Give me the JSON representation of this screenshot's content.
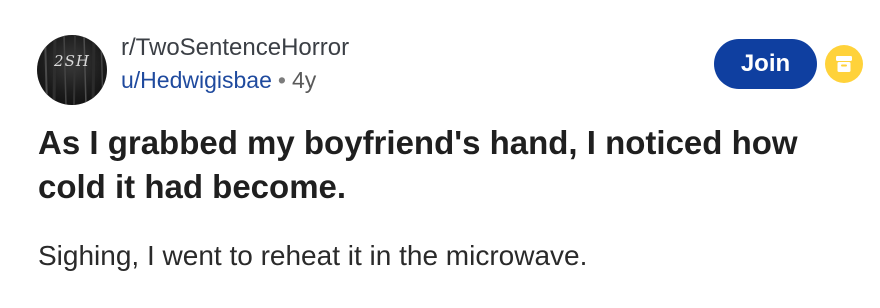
{
  "post": {
    "subreddit": "r/TwoSentenceHorror",
    "username": "u/Hedwigisbae",
    "separator": "•",
    "age": "4y",
    "avatar_text": "2SH",
    "join_label": "Join",
    "title": "As I grabbed my boyfriend's hand, I noticed how cold it had become.",
    "body": "Sighing, I went to reheat it in the microwave."
  },
  "icons": {
    "avatar": "community-avatar-icon",
    "badge": "archive-box-icon"
  },
  "colors": {
    "join_button": "#0f3fa0",
    "username": "#1f4a9e",
    "badge": "#ffd23a",
    "title": "#1f1f1f"
  }
}
